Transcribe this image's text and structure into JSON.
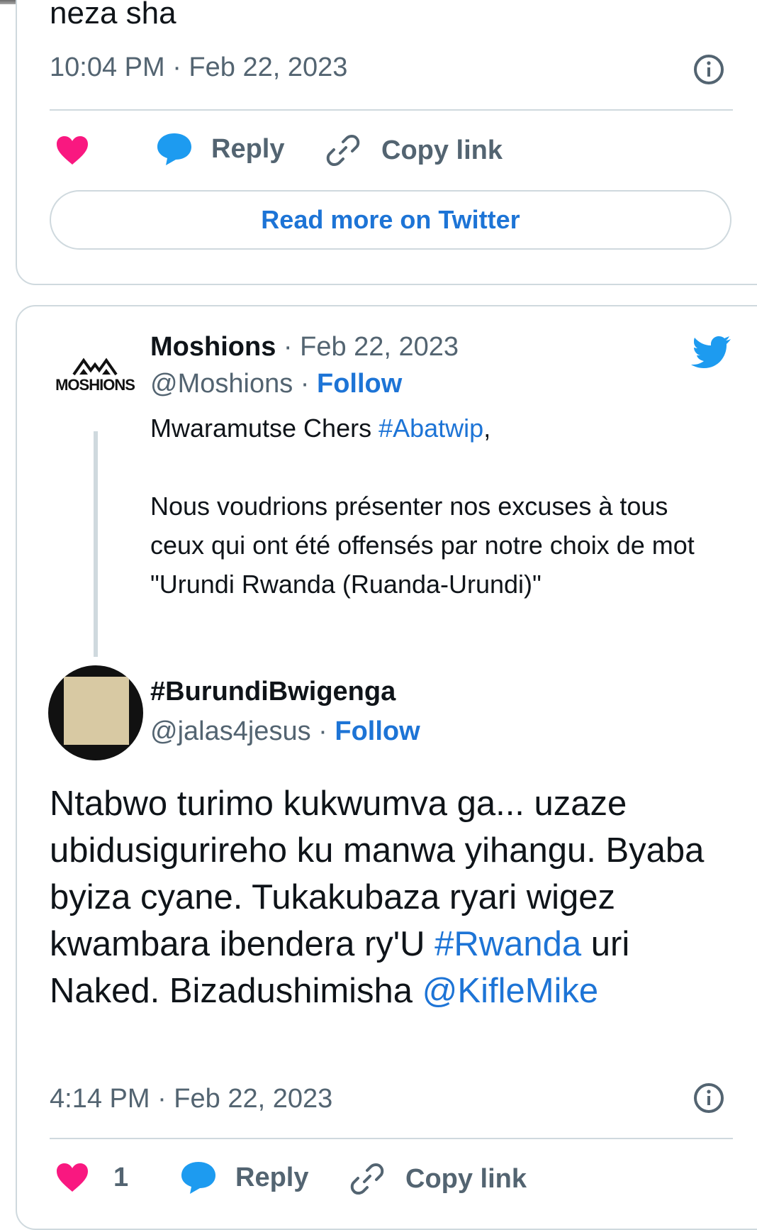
{
  "prev_tweet": {
    "text_tail": "neza sha",
    "timestamp": "10:04 PM · Feb 22, 2023",
    "actions": {
      "reply_label": "Reply",
      "copy_label": "Copy link"
    },
    "read_more": "Read more on Twitter"
  },
  "quoted_tweet": {
    "avatar_text": "MOSHIONS",
    "name": "Moshions",
    "date": "· Feb 22, 2023",
    "handle": "@Moshions ·",
    "follow": "Follow",
    "text_part1": "Mwaramutse Chers ",
    "hashtag": "#Abatwip",
    "text_part2": ",",
    "text_para2": "Nous voudrions présenter nos excuses à tous ceux qui ont été offensés par notre choix de mot \"Urundi Rwanda (Ruanda-Urundi)\""
  },
  "main_tweet": {
    "name": "#BurundiBwigenga",
    "handle": "@jalas4jesus ·",
    "follow": "Follow",
    "text_part1": "Ntabwo turimo kukwumva ga... uzaze ubidusigurireho ku manwa yihangu. Byaba byiza cyane. Tukakubaza ryari wigez kwambara ibendera ry'U ",
    "hashtag": "#Rwanda",
    "text_part2": " uri Naked. Bizadushimisha ",
    "mention": "@KifleMike",
    "timestamp": "4:14 PM · Feb 22, 2023",
    "like_count": "1",
    "actions": {
      "reply_label": "Reply",
      "copy_label": "Copy link"
    }
  },
  "colors": {
    "like": "#f91880",
    "reply": "#1d9bf0",
    "link": "#1d74d6",
    "gray": "#536471"
  }
}
